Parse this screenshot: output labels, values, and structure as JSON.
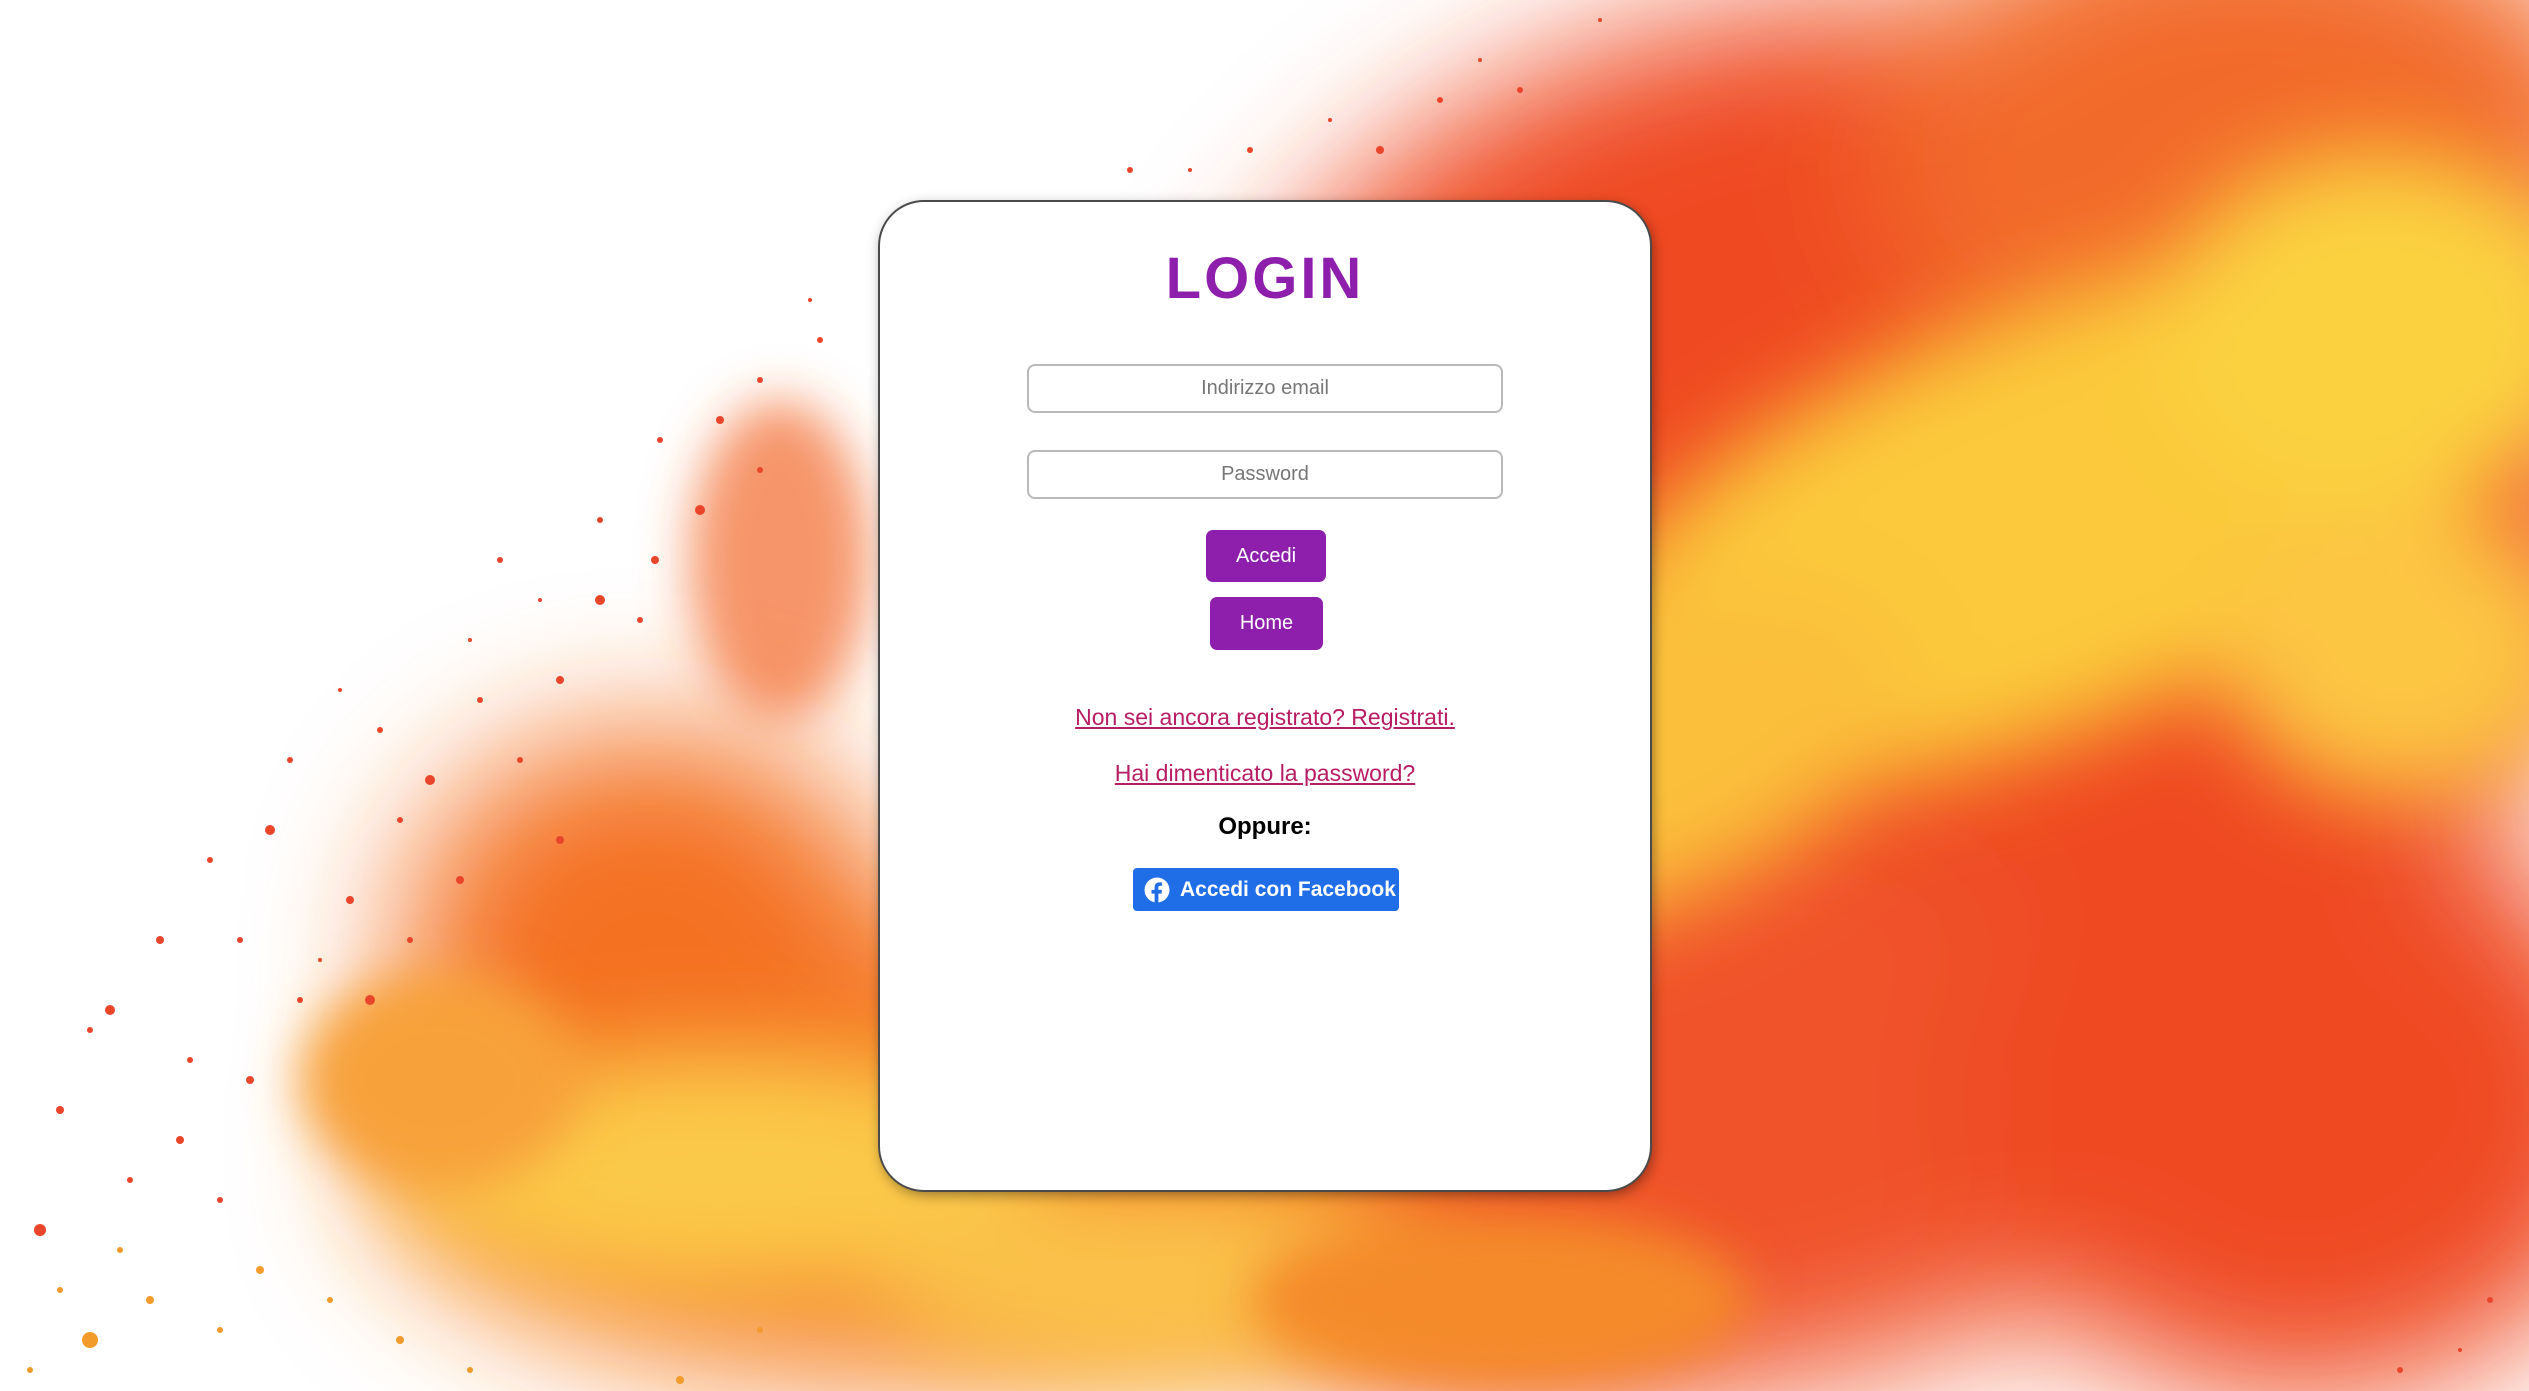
{
  "login": {
    "title": "LOGIN",
    "email_placeholder": "Indirizzo email",
    "password_placeholder": "Password",
    "accedi_label": "Accedi",
    "home_label": "Home",
    "register_link": "Non sei ancora registrato? Registrati.",
    "forgot_link": "Hai dimenticato la password?",
    "or_text": "Oppure:",
    "facebook_label": "Accedi con Facebook"
  },
  "icons": {
    "facebook": "facebook-icon"
  },
  "colors": {
    "accent": "#8e1fac",
    "link": "#b81c63",
    "facebook": "#1f6ee8",
    "splash_red": "#ef4a24",
    "splash_orange": "#f57c22",
    "splash_yellow": "#fbc93b"
  }
}
